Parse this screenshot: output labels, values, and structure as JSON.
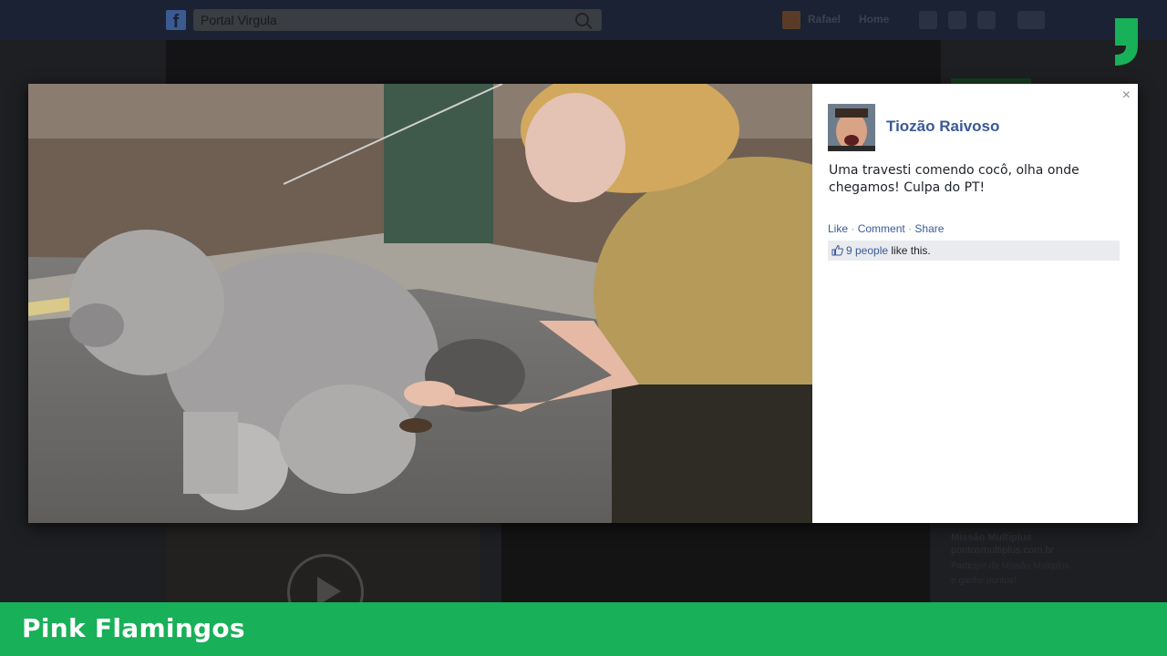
{
  "facebook": {
    "search": {
      "value": "Portal Virgula"
    },
    "user_name": "Rafael",
    "home_label": "Home",
    "sidebar_ad": {
      "title": "Missão Multiplus",
      "url": "pontosmultiplus.com.br",
      "text_line1": "Participe da Missão Multiplus",
      "text_line2": "e ganhe pontos!"
    }
  },
  "post": {
    "author": "Tiozão Raivoso",
    "caption": "Uma travesti comendo cocô, olha onde chegamos! Culpa do PT!",
    "actions": {
      "like": "Like",
      "comment": "Comment",
      "share": "Share",
      "separator": "·"
    },
    "likes": {
      "count_text": "9 people",
      "suffix": "like this."
    },
    "close_symbol": "×"
  },
  "banner": {
    "title": "Pink Flamingos"
  },
  "colors": {
    "brand_green": "#18b058",
    "facebook_link": "#3b5998",
    "panel_bg": "#ffffff",
    "overlay_dark": "#1e1f22"
  },
  "icons": [
    "facebook-logo-icon",
    "search-icon",
    "close-icon",
    "thumbs-up-icon",
    "play-icon",
    "brand-quote-icon"
  ]
}
